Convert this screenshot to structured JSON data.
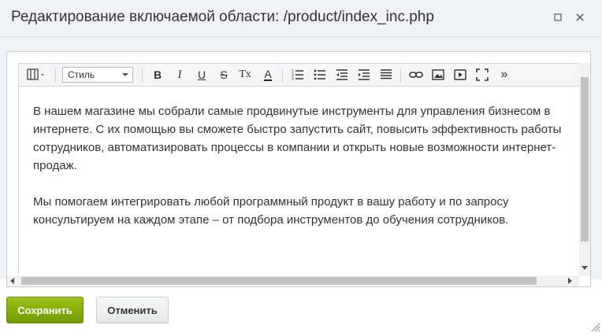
{
  "dialog": {
    "title": "Редактирование включаемой области: /product/index_inc.php"
  },
  "toolbar": {
    "style_select_value": "Стиль",
    "buttons": [
      {
        "name": "bold-icon",
        "glyph": "B"
      },
      {
        "name": "italic-icon",
        "glyph": "I"
      },
      {
        "name": "underline-icon",
        "glyph": "U"
      },
      {
        "name": "strikethrough-icon",
        "glyph": "S"
      },
      {
        "name": "clear-format-icon",
        "glyph": "Tx"
      },
      {
        "name": "font-color-icon",
        "glyph": "A"
      }
    ],
    "more_glyph": "»"
  },
  "content": {
    "paragraphs": [
      "В нашем магазине мы собрали самые продвинутые инструменты для управления бизнесом в интернете. С их помощью вы сможете быстро запустить сайт, повысить эффективность работы сотрудников, автоматизировать процессы в компании и открыть новые возможности интернет-продаж.",
      "Мы помогаем интегрировать любой программный продукт в вашу работу и по запросу консультируем на каждом этапе – от подбора инструментов до обучения сотрудников."
    ]
  },
  "footer": {
    "save_label": "Сохранить",
    "cancel_label": "Отменить"
  },
  "colors": {
    "save_button": "#86ad00",
    "titlebar": "#eef2f4"
  }
}
